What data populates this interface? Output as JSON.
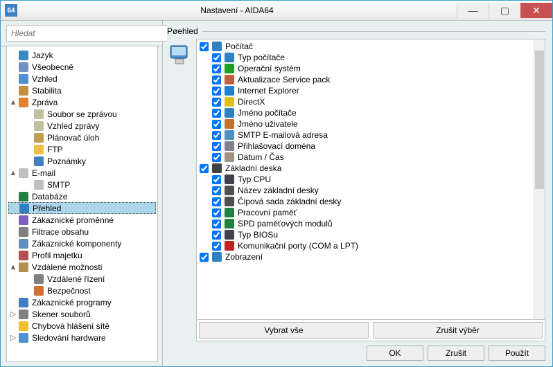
{
  "window": {
    "title": "Nastavení - AIDA64",
    "app_icon_text": "64"
  },
  "search": {
    "placeholder": "Hledat"
  },
  "section": {
    "title": "Pøehled"
  },
  "tree": [
    {
      "label": "Jazyk",
      "level": 0,
      "icon": "globe-icon",
      "color": "#3a88c8",
      "toggle": null
    },
    {
      "label": "Všeobecně",
      "level": 0,
      "icon": "gear-icon",
      "color": "#7090c0",
      "toggle": null
    },
    {
      "label": "Vzhled",
      "level": 0,
      "icon": "display-icon",
      "color": "#5090d0",
      "toggle": null
    },
    {
      "label": "Stabilita",
      "level": 0,
      "icon": "stability-icon",
      "color": "#c09040",
      "toggle": null
    },
    {
      "label": "Zpráva",
      "level": 0,
      "icon": "report-icon",
      "color": "#e08030",
      "toggle": "▲"
    },
    {
      "label": "Soubor se zprávou",
      "level": 1,
      "icon": "file-icon",
      "color": "#c0c0a0"
    },
    {
      "label": "Vzhled zprávy",
      "level": 1,
      "icon": "file-icon",
      "color": "#c0c0a0"
    },
    {
      "label": "Plánovač úloh",
      "level": 1,
      "icon": "clock-icon",
      "color": "#c0a050"
    },
    {
      "label": "FTP",
      "level": 1,
      "icon": "folder-icon",
      "color": "#f0c040"
    },
    {
      "label": "Poznámky",
      "level": 1,
      "icon": "info-icon",
      "color": "#4080c0"
    },
    {
      "label": "E-mail",
      "level": 0,
      "icon": "mail-icon",
      "color": "#c0c0c0",
      "toggle": "▲"
    },
    {
      "label": "SMTP",
      "level": 1,
      "icon": "mail-icon",
      "color": "#c0c0c0"
    },
    {
      "label": "Databáze",
      "level": 0,
      "icon": "db-icon",
      "color": "#208040",
      "toggle": null
    },
    {
      "label": "Přehled",
      "level": 0,
      "icon": "overview-icon",
      "color": "#3080c0",
      "selected": true,
      "toggle": null
    },
    {
      "label": "Zákaznické proměnné",
      "level": 0,
      "icon": "vars-icon",
      "color": "#8060c0",
      "toggle": null
    },
    {
      "label": "Filtrace obsahu",
      "level": 0,
      "icon": "filter-icon",
      "color": "#808080",
      "toggle": null
    },
    {
      "label": "Zákaznické komponenty",
      "level": 0,
      "icon": "components-icon",
      "color": "#6090c0",
      "toggle": null
    },
    {
      "label": "Profil majetku",
      "level": 0,
      "icon": "asset-icon",
      "color": "#b05050",
      "toggle": null
    },
    {
      "label": "Vzdálené možnosti",
      "level": 0,
      "icon": "remote-icon",
      "color": "#b09050",
      "toggle": "▲"
    },
    {
      "label": "Vzdálené řízení",
      "level": 1,
      "icon": "rc-icon",
      "color": "#808080"
    },
    {
      "label": "Bezpečnost",
      "level": 1,
      "icon": "lock-icon",
      "color": "#d07030"
    },
    {
      "label": "Zákaznické programy",
      "level": 0,
      "icon": "programs-icon",
      "color": "#4080c0",
      "toggle": null
    },
    {
      "label": "Skener souborů",
      "level": 0,
      "icon": "magnifier-icon",
      "color": "#808080",
      "toggle": "▷"
    },
    {
      "label": "Chybová hlášení sítě",
      "level": 0,
      "icon": "warning-icon",
      "color": "#f0c030",
      "toggle": null
    },
    {
      "label": "Sledování hardware",
      "level": 0,
      "icon": "monitor-icon",
      "color": "#5090d0",
      "toggle": "▷"
    }
  ],
  "checklist": [
    {
      "label": "Počítač",
      "level": 0,
      "checked": true,
      "icon": "computer-icon",
      "color": "#3080c0"
    },
    {
      "label": "Typ počítače",
      "level": 1,
      "checked": true,
      "icon": "computer-icon",
      "color": "#3080c0"
    },
    {
      "label": "Operační systém",
      "level": 1,
      "checked": true,
      "icon": "windows-icon",
      "color": "#20a020"
    },
    {
      "label": "Aktualizace Service pack",
      "level": 1,
      "checked": true,
      "icon": "package-icon",
      "color": "#c06040"
    },
    {
      "label": "Internet Explorer",
      "level": 1,
      "checked": true,
      "icon": "ie-icon",
      "color": "#2080d0"
    },
    {
      "label": "DirectX",
      "level": 1,
      "checked": true,
      "icon": "directx-icon",
      "color": "#e0c020"
    },
    {
      "label": "Jméno počítače",
      "level": 1,
      "checked": true,
      "icon": "computer-icon",
      "color": "#3080c0"
    },
    {
      "label": "Jméno uživatele",
      "level": 1,
      "checked": true,
      "icon": "user-icon",
      "color": "#c07030"
    },
    {
      "label": "SMTP E-mailová adresa",
      "level": 1,
      "checked": true,
      "icon": "mail-icon",
      "color": "#5090c0"
    },
    {
      "label": "Přihlašovací doména",
      "level": 1,
      "checked": true,
      "icon": "domain-icon",
      "color": "#808090"
    },
    {
      "label": "Datum / Čas",
      "level": 1,
      "checked": true,
      "icon": "calendar-icon",
      "color": "#a09080"
    },
    {
      "label": "Základní deska",
      "level": 0,
      "checked": true,
      "icon": "motherboard-icon",
      "color": "#404040"
    },
    {
      "label": "Typ CPU",
      "level": 1,
      "checked": true,
      "icon": "cpu-icon",
      "color": "#404050"
    },
    {
      "label": "Název základní desky",
      "level": 1,
      "checked": true,
      "icon": "board-icon",
      "color": "#505050"
    },
    {
      "label": "Čipová sada základní desky",
      "level": 1,
      "checked": true,
      "icon": "chipset-icon",
      "color": "#505050"
    },
    {
      "label": "Pracovní paměť",
      "level": 1,
      "checked": true,
      "icon": "ram-icon",
      "color": "#208040"
    },
    {
      "label": "SPD paměťových modulů",
      "level": 1,
      "checked": true,
      "icon": "spd-icon",
      "color": "#208040"
    },
    {
      "label": "Typ BIOSu",
      "level": 1,
      "checked": true,
      "icon": "bios-icon",
      "color": "#404050"
    },
    {
      "label": "Komunikační porty (COM a LPT)",
      "level": 1,
      "checked": true,
      "icon": "ports-icon",
      "color": "#c02020"
    },
    {
      "label": "Zobrazení",
      "level": 0,
      "checked": true,
      "icon": "display-icon",
      "color": "#3080c0"
    }
  ],
  "buttons": {
    "select_all": "Vybrat vše",
    "deselect_all": "Zrušit výběr",
    "ok": "OK",
    "cancel": "Zrušit",
    "apply": "Použít"
  }
}
